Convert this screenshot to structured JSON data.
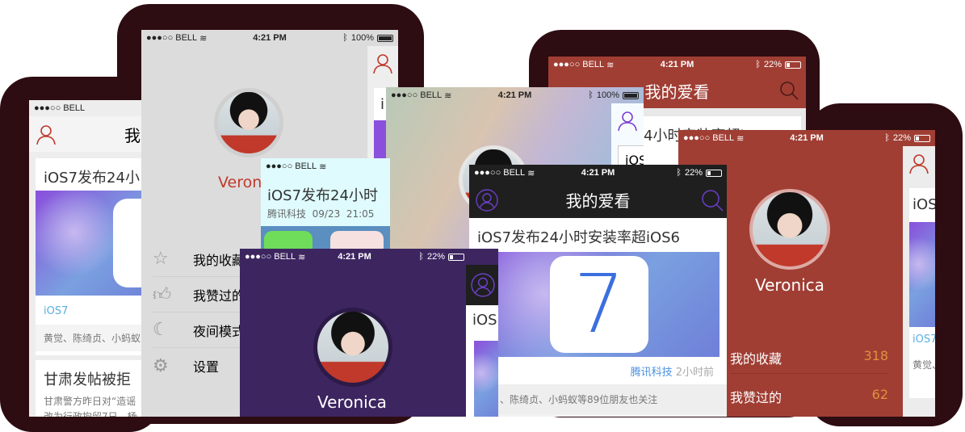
{
  "status": {
    "signal": "●●●○○",
    "carrier": "BELL",
    "time": "4:21 PM",
    "battery_low": "22%",
    "battery_full": "100%"
  },
  "header": {
    "title": "我的爱看",
    "title_partial": "我"
  },
  "article": {
    "title": "iOS7发布24小时安装率超iOS6",
    "title_short": "iOS7发布24小",
    "title_notif": "iOS7发布24小时",
    "title_back": "4小时安装率超iOS6",
    "tag": "iOS7",
    "source": "腾讯科技",
    "time_ago": "2小时前",
    "notif_meta": "腾讯科技  09/23  21:05",
    "friends": "黄觉、陈绮贞、小蚂蚁等89位朋友也关注",
    "friends_short": "黄觉、陈绮贞、小蚂蚁",
    "friends_cut": "、陈绮贞、小蚂蚁等89位朋友也关注",
    "ios_partial": "iOS",
    "seven": "7"
  },
  "article2": {
    "title": "甘肃发帖被拒",
    "line1": "甘肃警方昨日对“造谣",
    "line2": "改为行政拘留7日。杨"
  },
  "profile": {
    "name": "Veronica",
    "name_partial": "Veron"
  },
  "menu": [
    {
      "icon": "star-icon",
      "label": "我的收藏",
      "count": "318"
    },
    {
      "icon": "thumbs-up-icon",
      "label": "我赞过的",
      "count": "62"
    },
    {
      "icon": "moon-icon",
      "label": "夜间模式"
    },
    {
      "icon": "gear-icon",
      "label": "设置"
    }
  ],
  "colors": {
    "red": "#a03e34",
    "purple": "#3d2560",
    "black": "#1f1f1f",
    "accent_purple": "#6a3fc7",
    "link_blue": "#4a90e2",
    "count_orange": "#e0913a"
  }
}
